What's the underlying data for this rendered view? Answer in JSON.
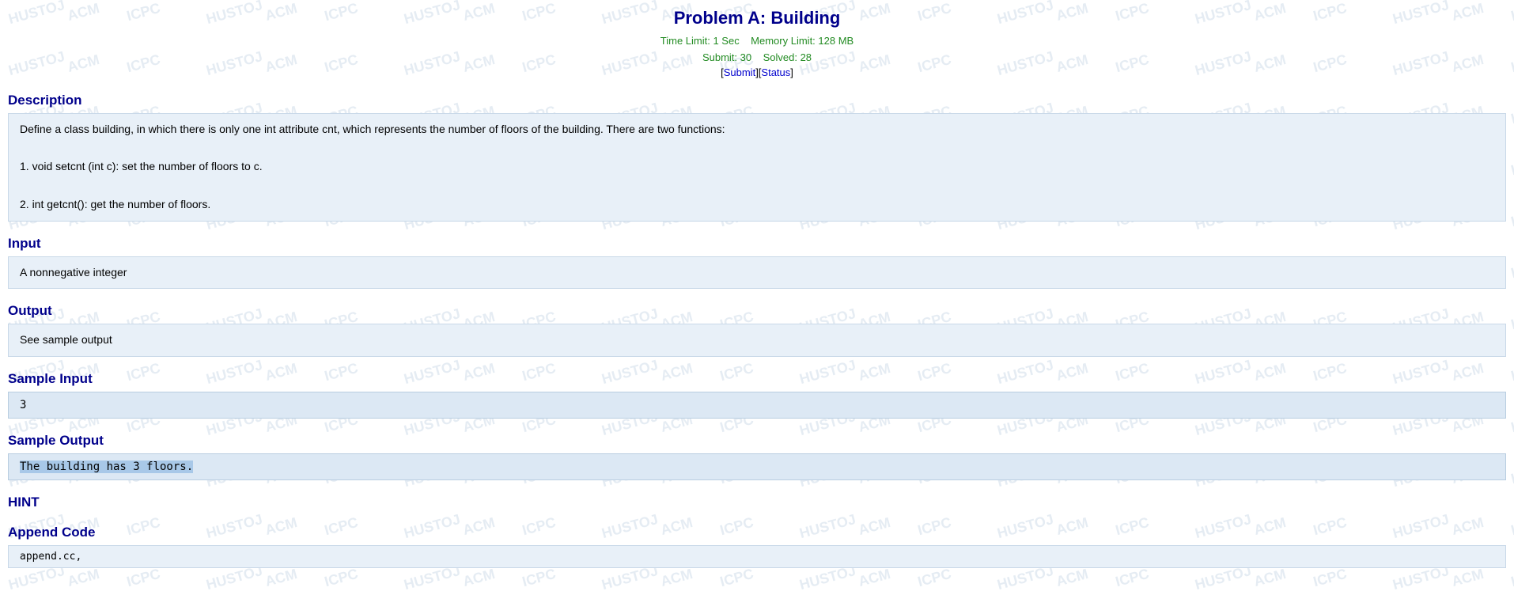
{
  "header": {
    "title": "Problem A: Building",
    "time_limit_label": "Time Limit:",
    "time_limit_value": "1 Sec",
    "memory_limit_label": "Memory Limit:",
    "memory_limit_value": "128 MB",
    "submit_label": "Submit:",
    "submit_value": "30",
    "solved_label": "Solved:",
    "solved_value": "28",
    "submit_link": "Submit",
    "status_link": "Status"
  },
  "description": {
    "heading": "Description",
    "text": "Define a class building, in which there is only one int attribute cnt, which represents the number of floors of the building. There are two functions:",
    "function1": "1. void setcnt (int c): set the number of floors to c.",
    "function2": "2. int getcnt(): get the number of floors."
  },
  "input": {
    "heading": "Input",
    "text": "A nonnegative integer"
  },
  "output": {
    "heading": "Output",
    "text": "See sample output"
  },
  "sample_input": {
    "heading": "Sample Input",
    "value": "3"
  },
  "sample_output": {
    "heading": "Sample Output",
    "value": "The building has 3 floors."
  },
  "hint": {
    "heading": "HINT"
  },
  "append_code": {
    "heading": "Append Code",
    "value": "append.cc,"
  },
  "watermark_texts": [
    "HUSTOJ",
    "ACM",
    "ICPC"
  ]
}
